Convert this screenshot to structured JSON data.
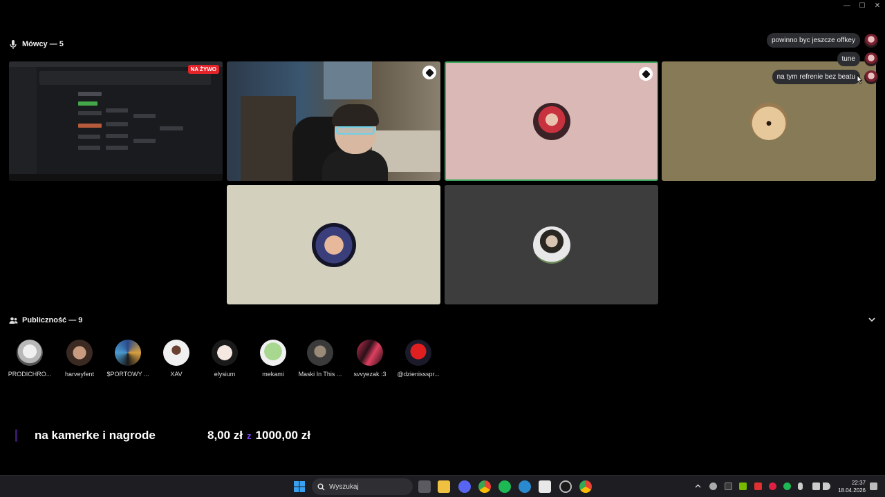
{
  "window": {
    "controls": [
      "minimize",
      "maximize",
      "close"
    ],
    "control_glyphs": [
      "—",
      "☐",
      "✕"
    ]
  },
  "speakers": {
    "label": "Mówcy — 5",
    "tiles": [
      {
        "name": "screen-share",
        "badge": "NA ŻYWO"
      },
      {
        "name": "camera"
      },
      {
        "name": "pink-avatar",
        "speaking": true
      },
      {
        "name": "dog-avatar"
      },
      {
        "name": "emblem-avatar"
      },
      {
        "name": "portrait-avatar"
      }
    ]
  },
  "chat_messages": [
    {
      "text": "powinno byc jeszcze offkey"
    },
    {
      "text": "tune"
    },
    {
      "text": "na tym refrenie bez beatu"
    }
  ],
  "audience": {
    "label": "Publiczność — 9",
    "members": [
      {
        "name": "PRODICHRO..."
      },
      {
        "name": "harveyfent"
      },
      {
        "name": "$PORTOWY ..."
      },
      {
        "name": "XAV"
      },
      {
        "name": "elysium"
      },
      {
        "name": "mekami"
      },
      {
        "name": "Maski In This ..."
      },
      {
        "name": "svvyezak :3"
      },
      {
        "name": "@dzienissspr..."
      }
    ]
  },
  "goal": {
    "title": "na kamerke i nagrode",
    "current": "8,00 zł",
    "separator": "z",
    "target": "1000,00 zł",
    "progress_fraction": 0.008
  },
  "taskbar": {
    "search_placeholder": "Wyszukaj",
    "time": "22:37",
    "date": "18.04.2026"
  },
  "colors": {
    "speaking": "#3ba55d",
    "live": "#e3242b",
    "goal_accent": "#7c3ff2"
  }
}
